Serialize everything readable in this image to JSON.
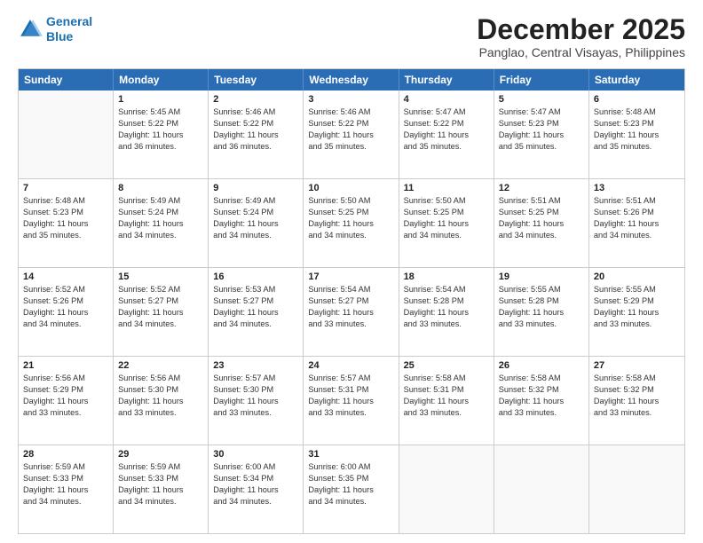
{
  "header": {
    "logo_line1": "General",
    "logo_line2": "Blue",
    "month_title": "December 2025",
    "location": "Panglao, Central Visayas, Philippines"
  },
  "days_of_week": [
    "Sunday",
    "Monday",
    "Tuesday",
    "Wednesday",
    "Thursday",
    "Friday",
    "Saturday"
  ],
  "weeks": [
    [
      {
        "day": "",
        "lines": []
      },
      {
        "day": "1",
        "lines": [
          "Sunrise: 5:45 AM",
          "Sunset: 5:22 PM",
          "Daylight: 11 hours",
          "and 36 minutes."
        ]
      },
      {
        "day": "2",
        "lines": [
          "Sunrise: 5:46 AM",
          "Sunset: 5:22 PM",
          "Daylight: 11 hours",
          "and 36 minutes."
        ]
      },
      {
        "day": "3",
        "lines": [
          "Sunrise: 5:46 AM",
          "Sunset: 5:22 PM",
          "Daylight: 11 hours",
          "and 35 minutes."
        ]
      },
      {
        "day": "4",
        "lines": [
          "Sunrise: 5:47 AM",
          "Sunset: 5:22 PM",
          "Daylight: 11 hours",
          "and 35 minutes."
        ]
      },
      {
        "day": "5",
        "lines": [
          "Sunrise: 5:47 AM",
          "Sunset: 5:23 PM",
          "Daylight: 11 hours",
          "and 35 minutes."
        ]
      },
      {
        "day": "6",
        "lines": [
          "Sunrise: 5:48 AM",
          "Sunset: 5:23 PM",
          "Daylight: 11 hours",
          "and 35 minutes."
        ]
      }
    ],
    [
      {
        "day": "7",
        "lines": [
          "Sunrise: 5:48 AM",
          "Sunset: 5:23 PM",
          "Daylight: 11 hours",
          "and 35 minutes."
        ]
      },
      {
        "day": "8",
        "lines": [
          "Sunrise: 5:49 AM",
          "Sunset: 5:24 PM",
          "Daylight: 11 hours",
          "and 34 minutes."
        ]
      },
      {
        "day": "9",
        "lines": [
          "Sunrise: 5:49 AM",
          "Sunset: 5:24 PM",
          "Daylight: 11 hours",
          "and 34 minutes."
        ]
      },
      {
        "day": "10",
        "lines": [
          "Sunrise: 5:50 AM",
          "Sunset: 5:25 PM",
          "Daylight: 11 hours",
          "and 34 minutes."
        ]
      },
      {
        "day": "11",
        "lines": [
          "Sunrise: 5:50 AM",
          "Sunset: 5:25 PM",
          "Daylight: 11 hours",
          "and 34 minutes."
        ]
      },
      {
        "day": "12",
        "lines": [
          "Sunrise: 5:51 AM",
          "Sunset: 5:25 PM",
          "Daylight: 11 hours",
          "and 34 minutes."
        ]
      },
      {
        "day": "13",
        "lines": [
          "Sunrise: 5:51 AM",
          "Sunset: 5:26 PM",
          "Daylight: 11 hours",
          "and 34 minutes."
        ]
      }
    ],
    [
      {
        "day": "14",
        "lines": [
          "Sunrise: 5:52 AM",
          "Sunset: 5:26 PM",
          "Daylight: 11 hours",
          "and 34 minutes."
        ]
      },
      {
        "day": "15",
        "lines": [
          "Sunrise: 5:52 AM",
          "Sunset: 5:27 PM",
          "Daylight: 11 hours",
          "and 34 minutes."
        ]
      },
      {
        "day": "16",
        "lines": [
          "Sunrise: 5:53 AM",
          "Sunset: 5:27 PM",
          "Daylight: 11 hours",
          "and 34 minutes."
        ]
      },
      {
        "day": "17",
        "lines": [
          "Sunrise: 5:54 AM",
          "Sunset: 5:27 PM",
          "Daylight: 11 hours",
          "and 33 minutes."
        ]
      },
      {
        "day": "18",
        "lines": [
          "Sunrise: 5:54 AM",
          "Sunset: 5:28 PM",
          "Daylight: 11 hours",
          "and 33 minutes."
        ]
      },
      {
        "day": "19",
        "lines": [
          "Sunrise: 5:55 AM",
          "Sunset: 5:28 PM",
          "Daylight: 11 hours",
          "and 33 minutes."
        ]
      },
      {
        "day": "20",
        "lines": [
          "Sunrise: 5:55 AM",
          "Sunset: 5:29 PM",
          "Daylight: 11 hours",
          "and 33 minutes."
        ]
      }
    ],
    [
      {
        "day": "21",
        "lines": [
          "Sunrise: 5:56 AM",
          "Sunset: 5:29 PM",
          "Daylight: 11 hours",
          "and 33 minutes."
        ]
      },
      {
        "day": "22",
        "lines": [
          "Sunrise: 5:56 AM",
          "Sunset: 5:30 PM",
          "Daylight: 11 hours",
          "and 33 minutes."
        ]
      },
      {
        "day": "23",
        "lines": [
          "Sunrise: 5:57 AM",
          "Sunset: 5:30 PM",
          "Daylight: 11 hours",
          "and 33 minutes."
        ]
      },
      {
        "day": "24",
        "lines": [
          "Sunrise: 5:57 AM",
          "Sunset: 5:31 PM",
          "Daylight: 11 hours",
          "and 33 minutes."
        ]
      },
      {
        "day": "25",
        "lines": [
          "Sunrise: 5:58 AM",
          "Sunset: 5:31 PM",
          "Daylight: 11 hours",
          "and 33 minutes."
        ]
      },
      {
        "day": "26",
        "lines": [
          "Sunrise: 5:58 AM",
          "Sunset: 5:32 PM",
          "Daylight: 11 hours",
          "and 33 minutes."
        ]
      },
      {
        "day": "27",
        "lines": [
          "Sunrise: 5:58 AM",
          "Sunset: 5:32 PM",
          "Daylight: 11 hours",
          "and 33 minutes."
        ]
      }
    ],
    [
      {
        "day": "28",
        "lines": [
          "Sunrise: 5:59 AM",
          "Sunset: 5:33 PM",
          "Daylight: 11 hours",
          "and 34 minutes."
        ]
      },
      {
        "day": "29",
        "lines": [
          "Sunrise: 5:59 AM",
          "Sunset: 5:33 PM",
          "Daylight: 11 hours",
          "and 34 minutes."
        ]
      },
      {
        "day": "30",
        "lines": [
          "Sunrise: 6:00 AM",
          "Sunset: 5:34 PM",
          "Daylight: 11 hours",
          "and 34 minutes."
        ]
      },
      {
        "day": "31",
        "lines": [
          "Sunrise: 6:00 AM",
          "Sunset: 5:35 PM",
          "Daylight: 11 hours",
          "and 34 minutes."
        ]
      },
      {
        "day": "",
        "lines": []
      },
      {
        "day": "",
        "lines": []
      },
      {
        "day": "",
        "lines": []
      }
    ]
  ]
}
